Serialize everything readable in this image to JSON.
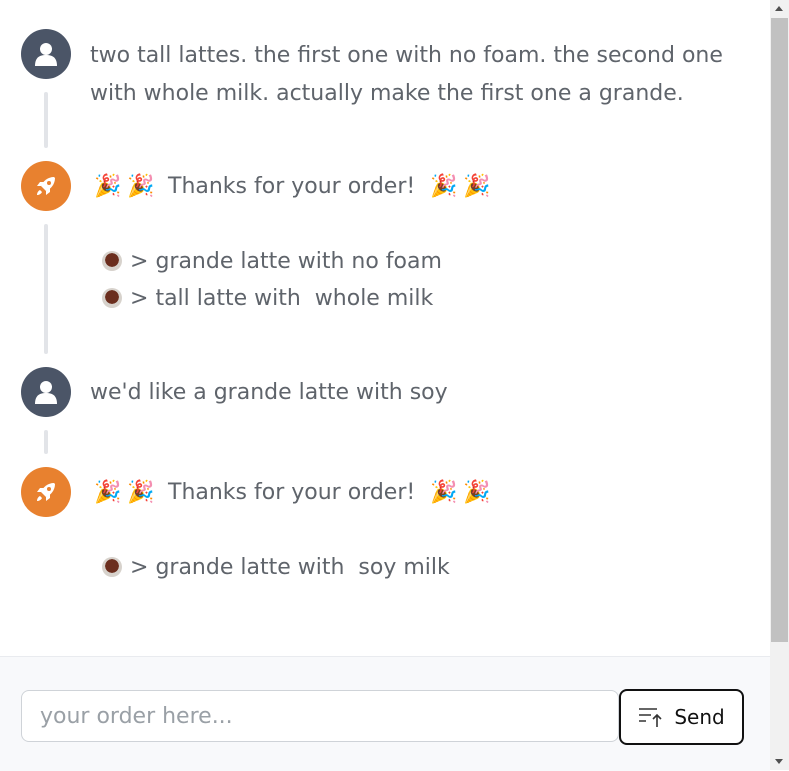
{
  "messages": [
    {
      "role": "user",
      "avatar_icon": "user-icon",
      "text": "two tall lattes. the first one with no foam. the second one with whole milk. actually make the first one a grande."
    },
    {
      "role": "bot",
      "avatar_icon": "rocket-icon",
      "confirmation": "Thanks for your order!",
      "emojis": [
        "🎉",
        "🎉",
        "🎉",
        "🎉"
      ],
      "items": [
        "grande latte with no foam",
        "tall latte with  whole milk"
      ]
    },
    {
      "role": "user",
      "avatar_icon": "user-icon",
      "text": "we'd like a grande latte with soy"
    },
    {
      "role": "bot",
      "avatar_icon": "rocket-icon",
      "confirmation": "Thanks for your order!",
      "emojis": [
        "🎉",
        "🎉",
        "🎉",
        "🎉"
      ],
      "items": [
        "grande latte with  soy milk"
      ]
    }
  ],
  "item_prefix": ">",
  "item_icon": "coffee-icon",
  "composer": {
    "placeholder": "your order here...",
    "value": "",
    "send_label": "Send",
    "send_icon": "sort-up-icon"
  },
  "colors": {
    "user_avatar": "#4b5567",
    "bot_avatar": "#e8812f",
    "text": "#5f646b"
  }
}
